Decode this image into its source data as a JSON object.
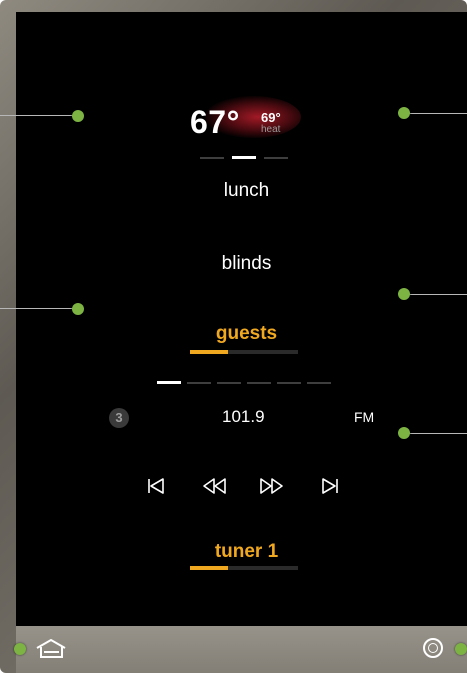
{
  "thermostat": {
    "current_temp": "67°",
    "set_temp": "69°",
    "mode": "heat"
  },
  "scenes": {
    "lunch": "lunch",
    "blinds": "blinds",
    "guests": "guests",
    "guests_level": 0.35
  },
  "tuner": {
    "preset_number": "3",
    "frequency": "101.9",
    "band": "FM",
    "source_label": "tuner 1",
    "level": 0.35,
    "controls": [
      "skip-back-icon",
      "rewind-icon",
      "fast-forward-icon",
      "skip-forward-icon"
    ]
  },
  "navigation": {
    "home_icon": "home-icon",
    "menu_icon": "menu-circle-icon"
  },
  "colors": {
    "accent": "#f0a820",
    "callout_dot": "#7cb342",
    "screen_bg": "#000000",
    "bezel": "#6f6b63"
  }
}
